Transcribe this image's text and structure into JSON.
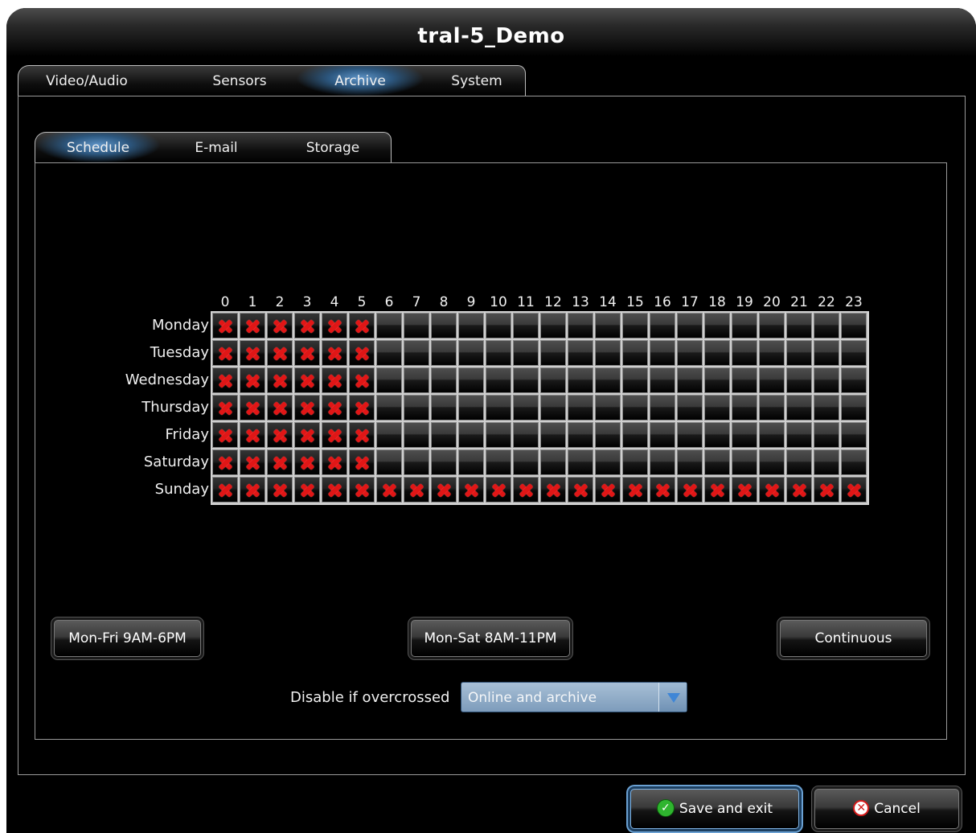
{
  "window": {
    "title": "tral-5_Demo"
  },
  "main_tabs": [
    {
      "label": "Video/Audio",
      "active": false
    },
    {
      "label": "Sensors",
      "active": false
    },
    {
      "label": "Archive",
      "active": true
    },
    {
      "label": "System",
      "active": false
    }
  ],
  "sub_tabs": [
    {
      "label": "Schedule",
      "active": true
    },
    {
      "label": "E-mail",
      "active": false
    },
    {
      "label": "Storage",
      "active": false
    }
  ],
  "schedule": {
    "hours": [
      "0",
      "1",
      "2",
      "3",
      "4",
      "5",
      "6",
      "7",
      "8",
      "9",
      "10",
      "11",
      "12",
      "13",
      "14",
      "15",
      "16",
      "17",
      "18",
      "19",
      "20",
      "21",
      "22",
      "23"
    ],
    "days": [
      "Monday",
      "Tuesday",
      "Wednesday",
      "Thursday",
      "Friday",
      "Saturday",
      "Sunday"
    ],
    "disabled_hours": {
      "Monday": [
        0,
        1,
        2,
        3,
        4,
        5
      ],
      "Tuesday": [
        0,
        1,
        2,
        3,
        4,
        5
      ],
      "Wednesday": [
        0,
        1,
        2,
        3,
        4,
        5
      ],
      "Thursday": [
        0,
        1,
        2,
        3,
        4,
        5
      ],
      "Friday": [
        0,
        1,
        2,
        3,
        4,
        5
      ],
      "Saturday": [
        0,
        1,
        2,
        3,
        4,
        5
      ],
      "Sunday": [
        0,
        1,
        2,
        3,
        4,
        5,
        6,
        7,
        8,
        9,
        10,
        11,
        12,
        13,
        14,
        15,
        16,
        17,
        18,
        19,
        20,
        21,
        22,
        23
      ]
    }
  },
  "presets": {
    "mon_fri": "Mon-Fri 9AM-6PM",
    "mon_sat": "Mon-Sat 8AM-11PM",
    "continuous": "Continuous"
  },
  "overcross": {
    "label": "Disable if overcrossed",
    "selected": "Online and archive"
  },
  "footer": {
    "save_label": "Save and exit",
    "cancel_label": "Cancel"
  },
  "icons": {
    "disabled_cell": "red-x-icon",
    "save": "check-circle-icon",
    "cancel": "x-circle-icon",
    "dropdown": "triangle-down-icon"
  },
  "colors": {
    "disabled_mark": "#e01616",
    "active_tab_glow": "#5d93c6",
    "select_bg": "#8fadc9"
  }
}
